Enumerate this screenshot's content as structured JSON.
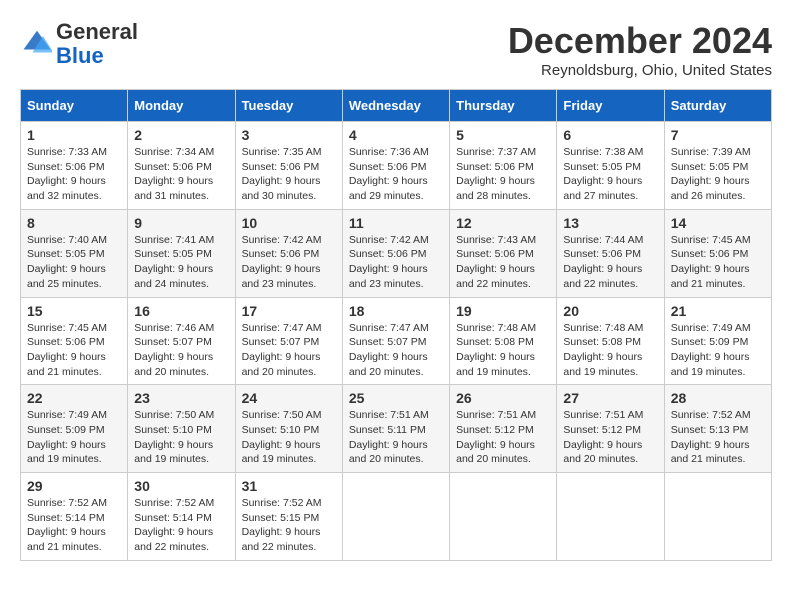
{
  "header": {
    "logo_line1": "General",
    "logo_line2": "Blue",
    "month_title": "December 2024",
    "location": "Reynoldsburg, Ohio, United States"
  },
  "weekdays": [
    "Sunday",
    "Monday",
    "Tuesday",
    "Wednesday",
    "Thursday",
    "Friday",
    "Saturday"
  ],
  "weeks": [
    [
      {
        "day": "1",
        "sunrise": "7:33 AM",
        "sunset": "5:06 PM",
        "daylight": "9 hours and 32 minutes."
      },
      {
        "day": "2",
        "sunrise": "7:34 AM",
        "sunset": "5:06 PM",
        "daylight": "9 hours and 31 minutes."
      },
      {
        "day": "3",
        "sunrise": "7:35 AM",
        "sunset": "5:06 PM",
        "daylight": "9 hours and 30 minutes."
      },
      {
        "day": "4",
        "sunrise": "7:36 AM",
        "sunset": "5:06 PM",
        "daylight": "9 hours and 29 minutes."
      },
      {
        "day": "5",
        "sunrise": "7:37 AM",
        "sunset": "5:06 PM",
        "daylight": "9 hours and 28 minutes."
      },
      {
        "day": "6",
        "sunrise": "7:38 AM",
        "sunset": "5:05 PM",
        "daylight": "9 hours and 27 minutes."
      },
      {
        "day": "7",
        "sunrise": "7:39 AM",
        "sunset": "5:05 PM",
        "daylight": "9 hours and 26 minutes."
      }
    ],
    [
      {
        "day": "8",
        "sunrise": "7:40 AM",
        "sunset": "5:05 PM",
        "daylight": "9 hours and 25 minutes."
      },
      {
        "day": "9",
        "sunrise": "7:41 AM",
        "sunset": "5:05 PM",
        "daylight": "9 hours and 24 minutes."
      },
      {
        "day": "10",
        "sunrise": "7:42 AM",
        "sunset": "5:06 PM",
        "daylight": "9 hours and 23 minutes."
      },
      {
        "day": "11",
        "sunrise": "7:42 AM",
        "sunset": "5:06 PM",
        "daylight": "9 hours and 23 minutes."
      },
      {
        "day": "12",
        "sunrise": "7:43 AM",
        "sunset": "5:06 PM",
        "daylight": "9 hours and 22 minutes."
      },
      {
        "day": "13",
        "sunrise": "7:44 AM",
        "sunset": "5:06 PM",
        "daylight": "9 hours and 22 minutes."
      },
      {
        "day": "14",
        "sunrise": "7:45 AM",
        "sunset": "5:06 PM",
        "daylight": "9 hours and 21 minutes."
      }
    ],
    [
      {
        "day": "15",
        "sunrise": "7:45 AM",
        "sunset": "5:06 PM",
        "daylight": "9 hours and 21 minutes."
      },
      {
        "day": "16",
        "sunrise": "7:46 AM",
        "sunset": "5:07 PM",
        "daylight": "9 hours and 20 minutes."
      },
      {
        "day": "17",
        "sunrise": "7:47 AM",
        "sunset": "5:07 PM",
        "daylight": "9 hours and 20 minutes."
      },
      {
        "day": "18",
        "sunrise": "7:47 AM",
        "sunset": "5:07 PM",
        "daylight": "9 hours and 20 minutes."
      },
      {
        "day": "19",
        "sunrise": "7:48 AM",
        "sunset": "5:08 PM",
        "daylight": "9 hours and 19 minutes."
      },
      {
        "day": "20",
        "sunrise": "7:48 AM",
        "sunset": "5:08 PM",
        "daylight": "9 hours and 19 minutes."
      },
      {
        "day": "21",
        "sunrise": "7:49 AM",
        "sunset": "5:09 PM",
        "daylight": "9 hours and 19 minutes."
      }
    ],
    [
      {
        "day": "22",
        "sunrise": "7:49 AM",
        "sunset": "5:09 PM",
        "daylight": "9 hours and 19 minutes."
      },
      {
        "day": "23",
        "sunrise": "7:50 AM",
        "sunset": "5:10 PM",
        "daylight": "9 hours and 19 minutes."
      },
      {
        "day": "24",
        "sunrise": "7:50 AM",
        "sunset": "5:10 PM",
        "daylight": "9 hours and 19 minutes."
      },
      {
        "day": "25",
        "sunrise": "7:51 AM",
        "sunset": "5:11 PM",
        "daylight": "9 hours and 20 minutes."
      },
      {
        "day": "26",
        "sunrise": "7:51 AM",
        "sunset": "5:12 PM",
        "daylight": "9 hours and 20 minutes."
      },
      {
        "day": "27",
        "sunrise": "7:51 AM",
        "sunset": "5:12 PM",
        "daylight": "9 hours and 20 minutes."
      },
      {
        "day": "28",
        "sunrise": "7:52 AM",
        "sunset": "5:13 PM",
        "daylight": "9 hours and 21 minutes."
      }
    ],
    [
      {
        "day": "29",
        "sunrise": "7:52 AM",
        "sunset": "5:14 PM",
        "daylight": "9 hours and 21 minutes."
      },
      {
        "day": "30",
        "sunrise": "7:52 AM",
        "sunset": "5:14 PM",
        "daylight": "9 hours and 22 minutes."
      },
      {
        "day": "31",
        "sunrise": "7:52 AM",
        "sunset": "5:15 PM",
        "daylight": "9 hours and 22 minutes."
      },
      null,
      null,
      null,
      null
    ]
  ]
}
